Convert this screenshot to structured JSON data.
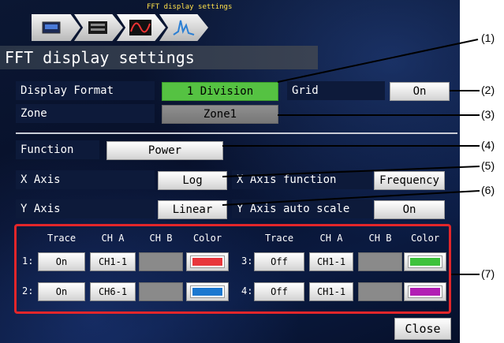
{
  "header": {
    "subtitle": "FFT display settings",
    "title": "FFT display settings"
  },
  "crumbs": [
    {
      "name": "instrument-icon"
    },
    {
      "name": "channel-icon"
    },
    {
      "name": "waveform-icon"
    },
    {
      "name": "spectrum-icon"
    }
  ],
  "display_format": {
    "label": "Display Format",
    "value": "1 Division"
  },
  "grid": {
    "label": "Grid",
    "value": "On"
  },
  "zone": {
    "label": "Zone",
    "value": "Zone1"
  },
  "function": {
    "label": "Function",
    "value": "Power"
  },
  "x_axis": {
    "label": "X Axis",
    "value": "Log",
    "function_label": "X Axis function",
    "function_value": "Frequency"
  },
  "y_axis": {
    "label": "Y Axis",
    "value": "Linear",
    "autoscale_label": "Y Axis auto scale",
    "autoscale_value": "On"
  },
  "traces": {
    "headers": [
      "Trace",
      "CH A",
      "CH B",
      "Color"
    ],
    "rows": [
      {
        "index": "1:",
        "trace": "On",
        "ch_a": "CH1-1",
        "ch_b": "",
        "color": "#e8363c"
      },
      {
        "index": "2:",
        "trace": "On",
        "ch_a": "CH6-1",
        "ch_b": "",
        "color": "#1b78d0"
      },
      {
        "index": "3:",
        "trace": "Off",
        "ch_a": "CH1-1",
        "ch_b": "",
        "color": "#3ec23c"
      },
      {
        "index": "4:",
        "trace": "Off",
        "ch_a": "CH1-1",
        "ch_b": "",
        "color": "#b21fb4"
      }
    ]
  },
  "close_button": "Close",
  "callouts": [
    "(1)",
    "(2)",
    "(3)",
    "(4)",
    "(5)",
    "(6)",
    "(7)"
  ]
}
